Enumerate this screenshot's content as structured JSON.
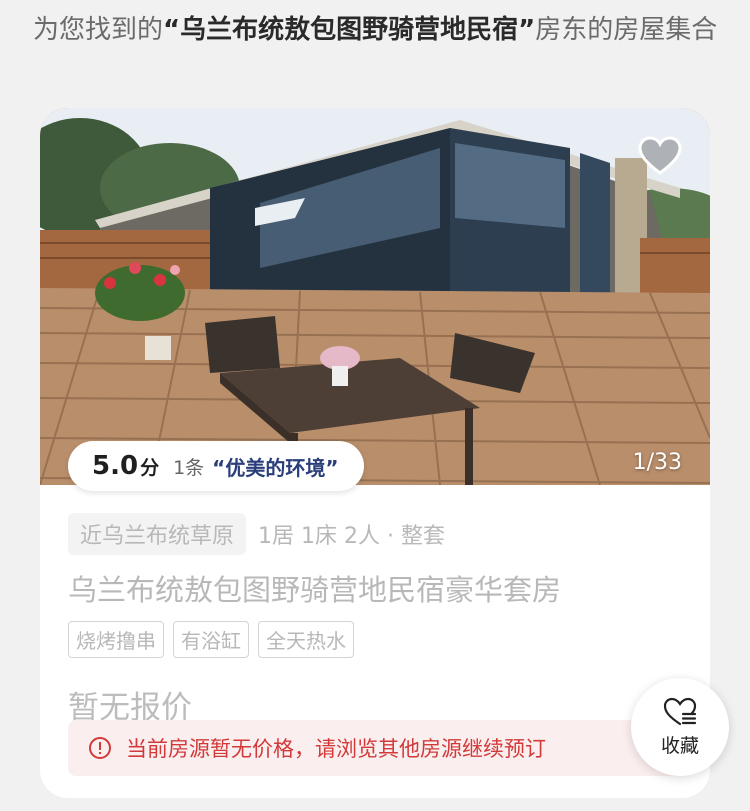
{
  "header": {
    "prefix": "为您找到的",
    "quoted_host": "“乌兰布统敖包图野骑营地民宿”",
    "suffix": "房东的房屋集合"
  },
  "listing": {
    "photo_counter": "1/33",
    "rating": {
      "score": "5.0",
      "unit": "分",
      "count": "1条",
      "quote": "“优美的环境”"
    },
    "location_tag": "近乌兰布统草原",
    "room_meta": "1居 1床 2人 · 整套",
    "title": "乌兰布统敖包图野骑营地民宿豪华套房",
    "tags": [
      "烧烤撸串",
      "有浴缸",
      "全天热水"
    ],
    "price_text": "暂无报价",
    "notice": "当前房源暂无价格，请浏览其他房源继续预订"
  },
  "actions": {
    "collect_label": "收藏"
  },
  "colors": {
    "notice_text": "#d23a3a",
    "notice_bg": "#fbeeee",
    "quote_text": "#2a3e7a"
  },
  "icons": [
    "heart-icon",
    "alert-circle-icon",
    "heart-list-icon"
  ]
}
